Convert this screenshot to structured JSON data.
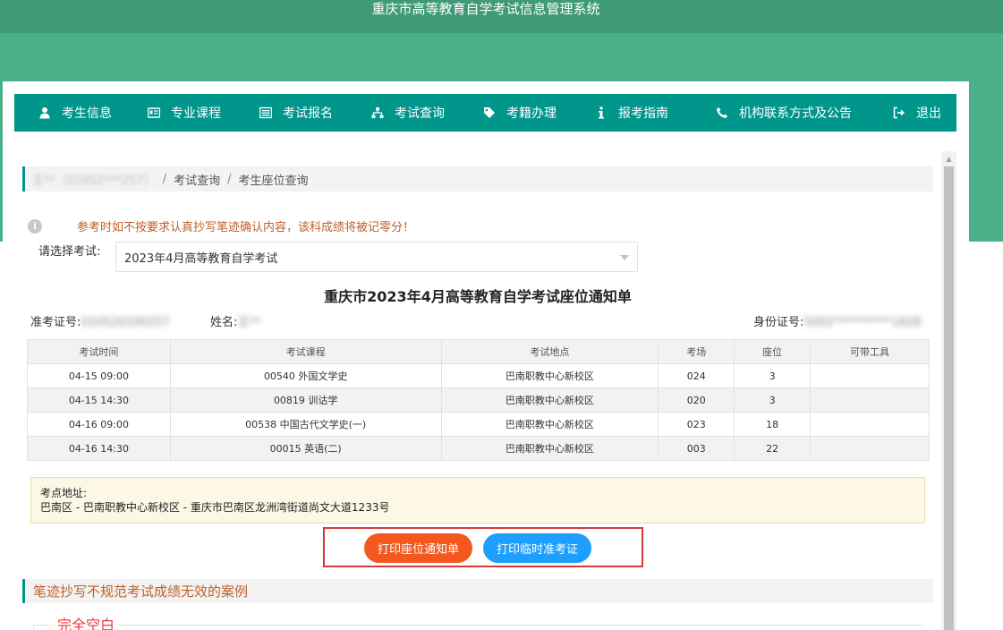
{
  "header": {
    "system_title": "重庆市高等教育自学考试信息管理系统"
  },
  "nav": {
    "items": [
      {
        "label": "考生信息",
        "icon": "user-icon"
      },
      {
        "label": "专业课程",
        "icon": "id-card-icon"
      },
      {
        "label": "考试报名",
        "icon": "list-icon"
      },
      {
        "label": "考试查询",
        "icon": "sitemap-icon"
      },
      {
        "label": "考籍办理",
        "icon": "tag-icon"
      },
      {
        "label": "报考指南",
        "icon": "info-icon"
      },
      {
        "label": "机构联系方式及公告",
        "icon": "phone-icon"
      },
      {
        "label": "退出",
        "icon": "sign-out-icon"
      }
    ]
  },
  "breadcrumb": {
    "user": "王**（01052***257）",
    "level1": "考试查询",
    "level2": "考生座位查询",
    "separator": "/"
  },
  "warning": "参考时如不按要求认真抄写笔迹确认内容，该科成绩将被记零分！",
  "exam_select": {
    "label": "请选择考试:",
    "value": "2023年4月高等教育自学考试"
  },
  "notice": {
    "title": "重庆市2023年4月高等教育自学考试座位通知单",
    "ticket_label": "准考证号:",
    "ticket_value": "010520100257",
    "name_label": "姓名:",
    "name_value": "王**",
    "id_label": "身份证号:",
    "id_value": "5002**********1828"
  },
  "table": {
    "headers": [
      "考试时间",
      "考试课程",
      "考试地点",
      "考场",
      "座位",
      "可带工具"
    ],
    "rows": [
      [
        "04-15 09:00",
        "00540 外国文学史",
        "巴南职教中心新校区",
        "024",
        "3",
        ""
      ],
      [
        "04-15 14:30",
        "00819 训诂学",
        "巴南职教中心新校区",
        "020",
        "3",
        ""
      ],
      [
        "04-16 09:00",
        "00538 中国古代文学史(一)",
        "巴南职教中心新校区",
        "023",
        "18",
        ""
      ],
      [
        "04-16 14:30",
        "00015 英语(二)",
        "巴南职教中心新校区",
        "003",
        "22",
        ""
      ]
    ]
  },
  "address": {
    "label": "考点地址:",
    "value": "巴南区 - 巴南职教中心新校区 - 重庆市巴南区龙洲湾街道尚文大道1233号"
  },
  "buttons": {
    "print_seat": "打印座位通知单",
    "print_ticket": "打印临时准考证"
  },
  "section": {
    "title": "笔迹抄写不规范考试成绩无效的案例",
    "case_label": "完全空白"
  },
  "colors": {
    "teal_nav": "#00968c",
    "green_band": "#4bb08a",
    "orange_button": "#f5581f",
    "blue_button": "#1e9fff",
    "highlight_frame": "#d33a3a"
  }
}
